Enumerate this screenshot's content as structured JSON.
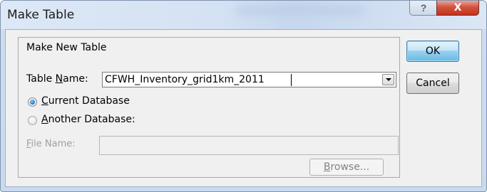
{
  "window": {
    "title": "Make Table",
    "help_glyph": "?",
    "close_glyph": "X"
  },
  "group": {
    "label": "Make New Table"
  },
  "table_name": {
    "label_prefix": "Table ",
    "label_accel": "N",
    "label_suffix": "ame:",
    "value": "CFWH_Inventory_grid1km_2011"
  },
  "destination": {
    "current": {
      "accel": "C",
      "rest": "urrent Database",
      "checked": true
    },
    "another": {
      "accel": "A",
      "rest": "nother Database:",
      "checked": false
    }
  },
  "file_name": {
    "accel": "F",
    "rest": "ile Name:",
    "value": ""
  },
  "buttons": {
    "ok": "OK",
    "cancel": "Cancel",
    "browse_accel": "B",
    "browse_rest": "rowse..."
  },
  "colors": {
    "accent_default_button": "#6ab9e2",
    "close_button": "#c2321b",
    "disabled_text": "#a0a0a0"
  }
}
